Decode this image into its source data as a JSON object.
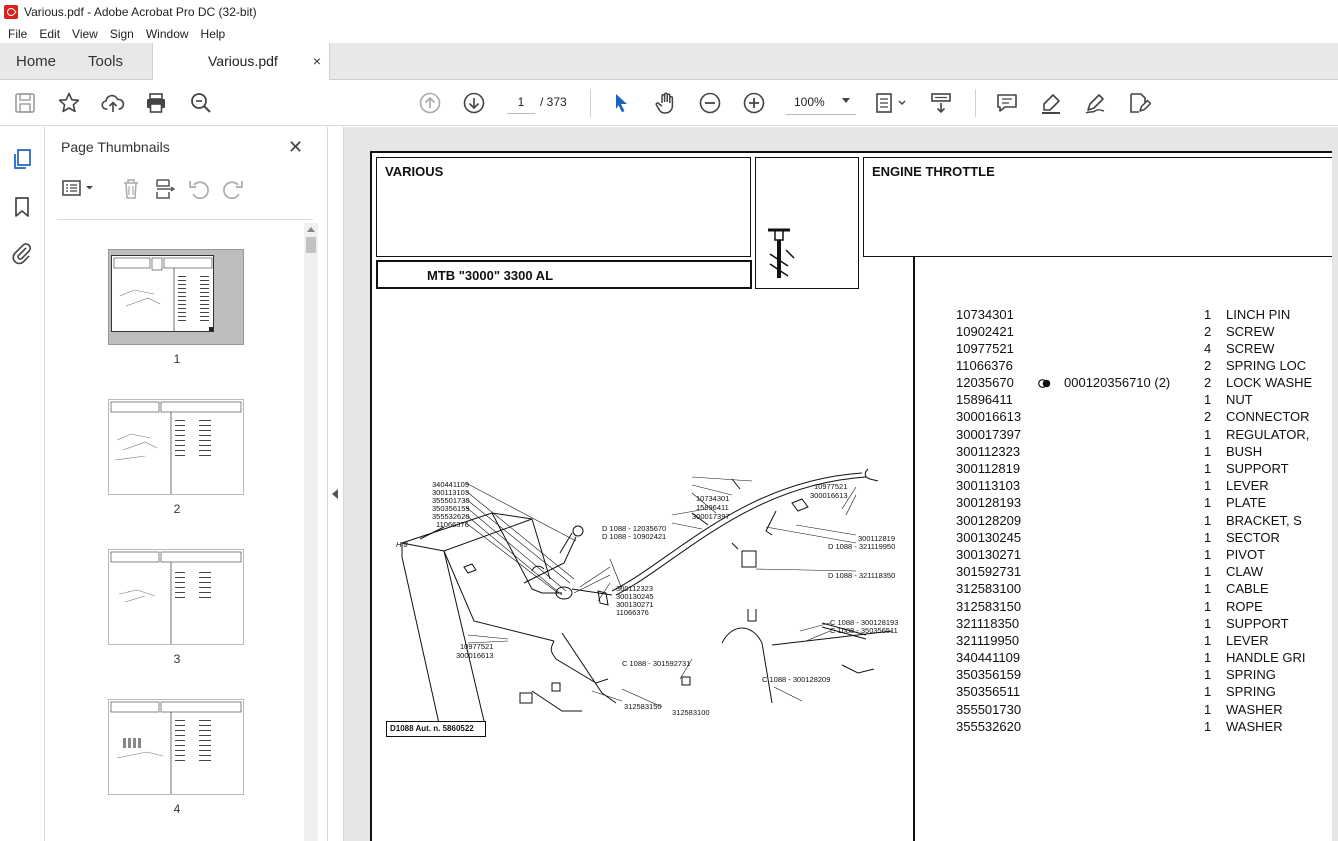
{
  "window": {
    "title": "Various.pdf - Adobe Acrobat Pro DC (32-bit)"
  },
  "menu": [
    "File",
    "Edit",
    "View",
    "Sign",
    "Window",
    "Help"
  ],
  "tabs": {
    "home": "Home",
    "tools": "Tools",
    "document": "Various.pdf",
    "close": "×"
  },
  "toolbar": {
    "page_current": "1",
    "page_total": "/ 373",
    "zoom": "100%"
  },
  "icons": {
    "save": "save-icon",
    "bookmark_star": "star-icon",
    "upload": "upload-icon",
    "print": "print-icon",
    "find": "search-zoom-icon",
    "prev": "arrow-up-circle-icon",
    "next": "arrow-down-circle-icon",
    "select": "cursor-icon",
    "hand": "hand-icon",
    "zoom_out": "zoom-out-icon",
    "zoom_in": "zoom-in-icon",
    "fit": "page-fit-icon",
    "scroll": "scroll-mode-icon",
    "comment": "comment-icon",
    "highlight": "highlight-icon",
    "draw": "pen-icon",
    "fill_sign": "fill-sign-icon"
  },
  "thumb_panel": {
    "title": "Page Thumbnails",
    "close": "✕",
    "pages": [
      {
        "label": "1",
        "selected": true
      },
      {
        "label": "2",
        "selected": false
      },
      {
        "label": "3",
        "selected": false
      },
      {
        "label": "4",
        "selected": false
      }
    ]
  },
  "document": {
    "section": "VARIOUS",
    "title": "ENGINE THROTTLE",
    "model": "MTB \"3000\" 3300 AL",
    "drawing_ref": "D1088 Aut. n. 5860522",
    "callouts": [
      "340441109",
      "300113103",
      "355501730",
      "350356159",
      "355532620",
      "11066376",
      "H 8",
      "10734301",
      "15896411",
      "300017397",
      "D 1088 - 12035670",
      "D 1088 - 10902421",
      "10977521",
      "300016613",
      "300112819",
      "D 1088 - 321119950",
      "D 1088 - 321118350",
      "300112323",
      "300130245",
      "300130271",
      "11066376",
      "C 1088 - 300128193",
      "C 1088 - 350356511",
      "10977521",
      "300016613",
      "C 1088 - 301592731",
      "C 1088 - 300128209",
      "312583150",
      "312583100"
    ],
    "parts": [
      {
        "number": "10734301",
        "qty": "1",
        "desc": "LINCH PIN"
      },
      {
        "number": "10902421",
        "qty": "2",
        "desc": "SCREW"
      },
      {
        "number": "10977521",
        "qty": "4",
        "desc": "SCREW"
      },
      {
        "number": "11066376",
        "qty": "2",
        "desc": "SPRING LOC"
      },
      {
        "number": "12035670",
        "qty": "2",
        "desc": "LOCK WASHE",
        "note": "000120356710  (2)"
      },
      {
        "number": "15896411",
        "qty": "1",
        "desc": "NUT"
      },
      {
        "number": "300016613",
        "qty": "2",
        "desc": "CONNECTOR"
      },
      {
        "number": "300017397",
        "qty": "1",
        "desc": "REGULATOR,"
      },
      {
        "number": "300112323",
        "qty": "1",
        "desc": "BUSH"
      },
      {
        "number": "300112819",
        "qty": "1",
        "desc": "SUPPORT"
      },
      {
        "number": "300113103",
        "qty": "1",
        "desc": "LEVER"
      },
      {
        "number": "300128193",
        "qty": "1",
        "desc": "PLATE"
      },
      {
        "number": "300128209",
        "qty": "1",
        "desc": "BRACKET, S"
      },
      {
        "number": "300130245",
        "qty": "1",
        "desc": "SECTOR"
      },
      {
        "number": "300130271",
        "qty": "1",
        "desc": "PIVOT"
      },
      {
        "number": "301592731",
        "qty": "1",
        "desc": "CLAW"
      },
      {
        "number": "312583100",
        "qty": "1",
        "desc": "CABLE"
      },
      {
        "number": "312583150",
        "qty": "1",
        "desc": "ROPE"
      },
      {
        "number": "321118350",
        "qty": "1",
        "desc": "SUPPORT"
      },
      {
        "number": "321119950",
        "qty": "1",
        "desc": "LEVER"
      },
      {
        "number": "340441109",
        "qty": "1",
        "desc": "HANDLE GRI"
      },
      {
        "number": "350356159",
        "qty": "1",
        "desc": "SPRING"
      },
      {
        "number": "350356511",
        "qty": "1",
        "desc": "SPRING"
      },
      {
        "number": "355501730",
        "qty": "1",
        "desc": "WASHER"
      },
      {
        "number": "355532620",
        "qty": "1",
        "desc": "WASHER"
      }
    ]
  }
}
